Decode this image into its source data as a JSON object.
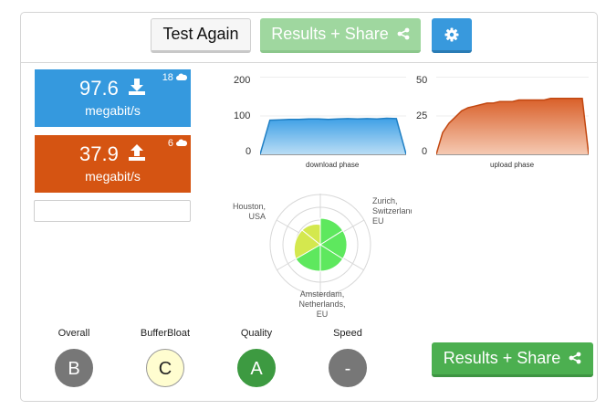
{
  "toolbar": {
    "test_again_label": "Test Again",
    "results_share_label": "Results + Share",
    "share_icon": "share-icon",
    "settings_icon": "gear-icon"
  },
  "download": {
    "value": "97.6",
    "unit": "megabit/s",
    "servers": "18",
    "icon": "download-icon",
    "color": "#3599de"
  },
  "upload": {
    "value": "37.9",
    "unit": "megabit/s",
    "servers": "6",
    "icon": "upload-icon",
    "color": "#d55412"
  },
  "graphs": {
    "download": {
      "ticks": [
        "200",
        "100",
        "0"
      ],
      "label": "download phase",
      "ymax": 200,
      "values": [
        0,
        88,
        89,
        90,
        90,
        91,
        91,
        90,
        91,
        92,
        91,
        92,
        91,
        93,
        92,
        0
      ]
    },
    "upload": {
      "ticks": [
        "50",
        "25",
        "0"
      ],
      "label": "upload phase",
      "ymax": 50,
      "values": [
        0,
        14,
        20,
        24,
        28,
        30,
        31,
        32,
        33,
        33,
        34,
        34,
        34,
        35,
        35,
        35,
        35,
        35,
        36,
        36,
        36,
        36,
        36,
        36,
        0
      ]
    }
  },
  "servers_map": {
    "houston": [
      "Houston,",
      "USA"
    ],
    "zurich": [
      "Zurich,",
      "Switzerland,",
      "EU"
    ],
    "amsterdam": [
      "Amsterdam,",
      "Netherlands,",
      "EU"
    ]
  },
  "grades": [
    {
      "label": "Overall",
      "grade": "B",
      "bg": "#777777",
      "fg": "#ffffff",
      "border": "#777777"
    },
    {
      "label": "BufferBloat",
      "grade": "C",
      "bg": "#fffdd0",
      "fg": "#222222",
      "border": "#999999"
    },
    {
      "label": "Quality",
      "grade": "A",
      "bg": "#3d9a41",
      "fg": "#ffffff",
      "border": "#3d9a41"
    },
    {
      "label": "Speed",
      "grade": "-",
      "bg": "#777777",
      "fg": "#ffffff",
      "border": "#777777"
    }
  ],
  "bottom": {
    "results_share_label": "Results + Share"
  }
}
